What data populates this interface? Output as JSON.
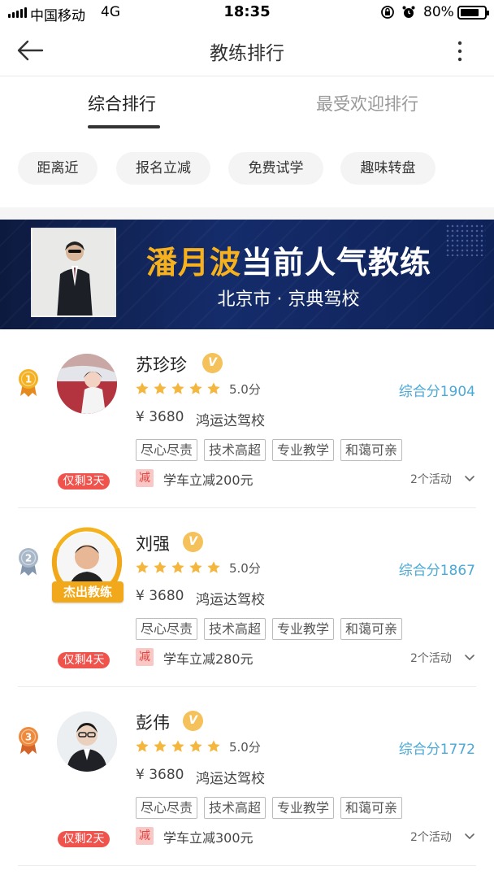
{
  "status_bar": {
    "carrier": "中国移动",
    "network": "4G",
    "time": "18:35",
    "battery": "80%",
    "battery_level": 0.8,
    "icons": [
      "signal-icon",
      "screen-lock-icon",
      "alarm-icon",
      "battery-icon"
    ]
  },
  "nav": {
    "title": "教练排行",
    "icons": [
      "back-arrow-icon",
      "more-vertical-icon"
    ]
  },
  "tabs": [
    {
      "label": "综合排行",
      "active": true
    },
    {
      "label": "最受欢迎排行",
      "active": false
    }
  ],
  "filters": [
    "距离近",
    "报名立减",
    "免费试学",
    "趣味转盘"
  ],
  "banner": {
    "name": "潘月波",
    "headline_rest": "当前人气教练",
    "subtitle": "北京市 · 京典驾校"
  },
  "coaches": [
    {
      "rank": "1",
      "name": "苏珍珍",
      "verified": "V",
      "score": "5.0分",
      "composite": "综合分1904",
      "price": "¥ 3680",
      "school": "鸿运达驾校",
      "tags": [
        "尽心尽责",
        "技术高超",
        "专业教学",
        "和蔼可亲"
      ],
      "remaining": "仅剩3天",
      "discount_mark": "减",
      "discount": "学车立减200元",
      "activities": "2个活动",
      "stars": 5
    },
    {
      "rank": "2",
      "name": "刘强",
      "verified": "V",
      "score": "5.0分",
      "composite": "综合分1867",
      "price": "¥ 3680",
      "school": "鸿运达驾校",
      "tags": [
        "尽心尽责",
        "技术高超",
        "专业教学",
        "和蔼可亲"
      ],
      "remaining": "仅剩4天",
      "discount_mark": "减",
      "discount": "学车立减280元",
      "activities": "2个活动",
      "stars": 5,
      "avatar_badge": "杰出教练"
    },
    {
      "rank": "3",
      "name": "彭伟",
      "verified": "V",
      "score": "5.0分",
      "composite": "综合分1772",
      "price": "¥ 3680",
      "school": "鸿运达驾校",
      "tags": [
        "尽心尽责",
        "技术高超",
        "专业教学",
        "和蔼可亲"
      ],
      "remaining": "仅剩2天",
      "discount_mark": "减",
      "discount": "学车立减300元",
      "activities": "2个活动",
      "stars": 5
    }
  ],
  "colors": {
    "accent_blue": "#4aa9d6",
    "star_gold": "#f4b63c",
    "badge_red": "#f0524c",
    "banner_navy": "#152c6b",
    "banner_name": "#f7b11c"
  }
}
